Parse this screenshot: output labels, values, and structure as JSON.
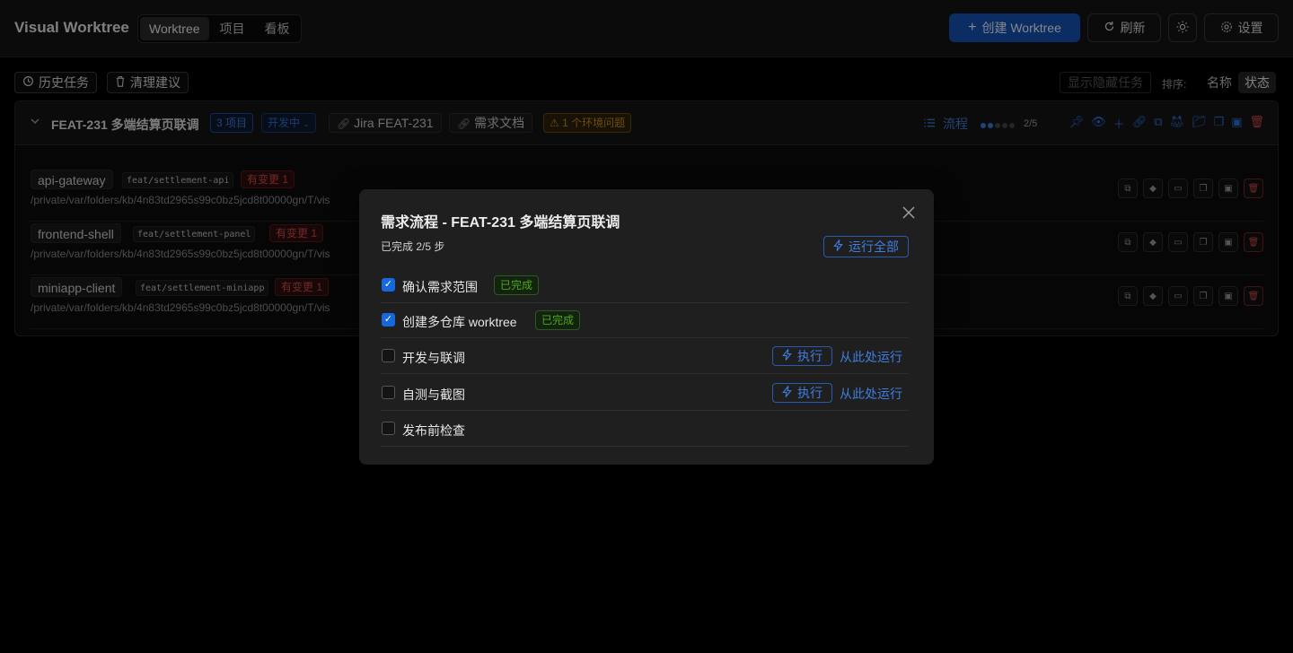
{
  "app": {
    "title": "Visual Worktree",
    "tabs": [
      "Worktree",
      "项目",
      "看板"
    ],
    "active_tab": "Worktree",
    "create_label": "创建 Worktree",
    "refresh_label": "刷新",
    "settings_label": "设置"
  },
  "toolbar": {
    "history_label": "历史任务",
    "cleanup_label": "清理建议",
    "show_hidden_label": "显示隐藏任务",
    "sort_label": "排序:",
    "sort_options": [
      "名称",
      "状态"
    ],
    "sort_active": "状态"
  },
  "group": {
    "title": "FEAT-231 多端结算页联调",
    "project_count": "3 项目",
    "status": "开发中",
    "jira_label": "Jira FEAT-231",
    "doc_label": "需求文档",
    "env_issue": "1 个环境问题",
    "flow_label": "流程",
    "flow_progress": "2/5",
    "flow_done": 2,
    "flow_total": 5
  },
  "repos": [
    {
      "name": "api-gateway",
      "branch": "feat/settlement-api",
      "changes": "有变更 1",
      "path": "/private/var/folders/kb/4n83td2965s99c0bz5jcd8t00000gn/T/vis"
    },
    {
      "name": "frontend-shell",
      "branch": "feat/settlement-panel",
      "changes": "有变更 1",
      "path": "/private/var/folders/kb/4n83td2965s99c0bz5jcd8t00000gn/T/vis"
    },
    {
      "name": "miniapp-client",
      "branch": "feat/settlement-miniapp",
      "changes": "有变更 1",
      "path": "/private/var/folders/kb/4n83td2965s99c0bz5jcd8t00000gn/T/vis"
    }
  ],
  "modal": {
    "title": "需求流程 - FEAT-231 多端结算页联调",
    "progress": "已完成 2/5 步",
    "run_all_label": "运行全部",
    "done_tag": "已完成",
    "exec_label": "执行",
    "from_here_label": "从此处运行",
    "steps": [
      {
        "label": "确认需求范围",
        "checked": true
      },
      {
        "label": "创建多仓库 worktree",
        "checked": true
      },
      {
        "label": "开发与联调",
        "checked": false
      },
      {
        "label": "自测与截图",
        "checked": false
      },
      {
        "label": "发布前检查",
        "checked": false
      }
    ]
  },
  "colors": {
    "accent": "#1552b4",
    "link": "#3f7ee2",
    "success": "#49aa19",
    "danger": "#d24a4a",
    "warning": "#c98b1c"
  }
}
